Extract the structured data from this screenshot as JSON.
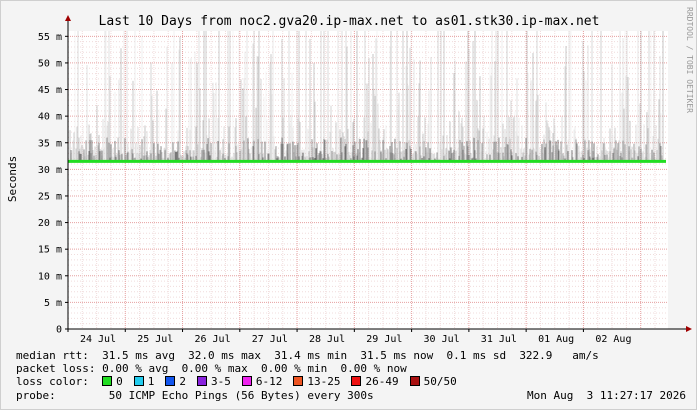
{
  "chart_data": {
    "type": "area",
    "title": "Last 10 Days from noc2.gva20.ip-max.net to as01.stk30.ip-max.net",
    "ylabel": "Seconds",
    "xlabel": "",
    "ylim": [
      0,
      56
    ],
    "yticks": [
      {
        "v": 0,
        "label": "0"
      },
      {
        "v": 5,
        "label": "5 m"
      },
      {
        "v": 10,
        "label": "10 m"
      },
      {
        "v": 15,
        "label": "15 m"
      },
      {
        "v": 20,
        "label": "20 m"
      },
      {
        "v": 25,
        "label": "25 m"
      },
      {
        "v": 30,
        "label": "30 m"
      },
      {
        "v": 35,
        "label": "35 m"
      },
      {
        "v": 40,
        "label": "40 m"
      },
      {
        "v": 45,
        "label": "45 m"
      },
      {
        "v": 50,
        "label": "50 m"
      },
      {
        "v": 55,
        "label": "55 m"
      }
    ],
    "xlim": [
      "2026-07-24",
      "2026-08-03T11:27"
    ],
    "xticks": [
      "24 Jul",
      "25 Jul",
      "26 Jul",
      "27 Jul",
      "28 Jul",
      "29 Jul",
      "30 Jul",
      "31 Jul",
      "01 Aug",
      "02 Aug"
    ],
    "median_rtt_ms": 31.5,
    "packet_loss_pct": 0.0,
    "grid": true
  },
  "side_label": "RRDTOOL / TOBI OETIKER",
  "stats": {
    "median_rtt": "median rtt:  31.5 ms avg  32.0 ms max  31.4 ms min  31.5 ms now  0.1 ms sd  322.9   am/s",
    "packet_loss": "packet loss: 0.00 % avg  0.00 % max  0.00 % min  0.00 % now",
    "loss_color_label": "loss color:",
    "probe_label": "probe:",
    "probe_text": "50 ICMP Echo Pings (56 Bytes) every 300s",
    "timestamp": "Mon Aug  3 11:27:17 2026"
  },
  "loss_colors": [
    {
      "label": "0",
      "color": "#22dd22"
    },
    {
      "label": "1",
      "color": "#22ccee"
    },
    {
      "label": "2",
      "color": "#1155ee"
    },
    {
      "label": "3-5",
      "color": "#8822dd"
    },
    {
      "label": "6-12",
      "color": "#ee22ee"
    },
    {
      "label": "13-25",
      "color": "#ee5522"
    },
    {
      "label": "26-49",
      "color": "#ee1111"
    },
    {
      "label": "50/50",
      "color": "#aa1111"
    }
  ]
}
